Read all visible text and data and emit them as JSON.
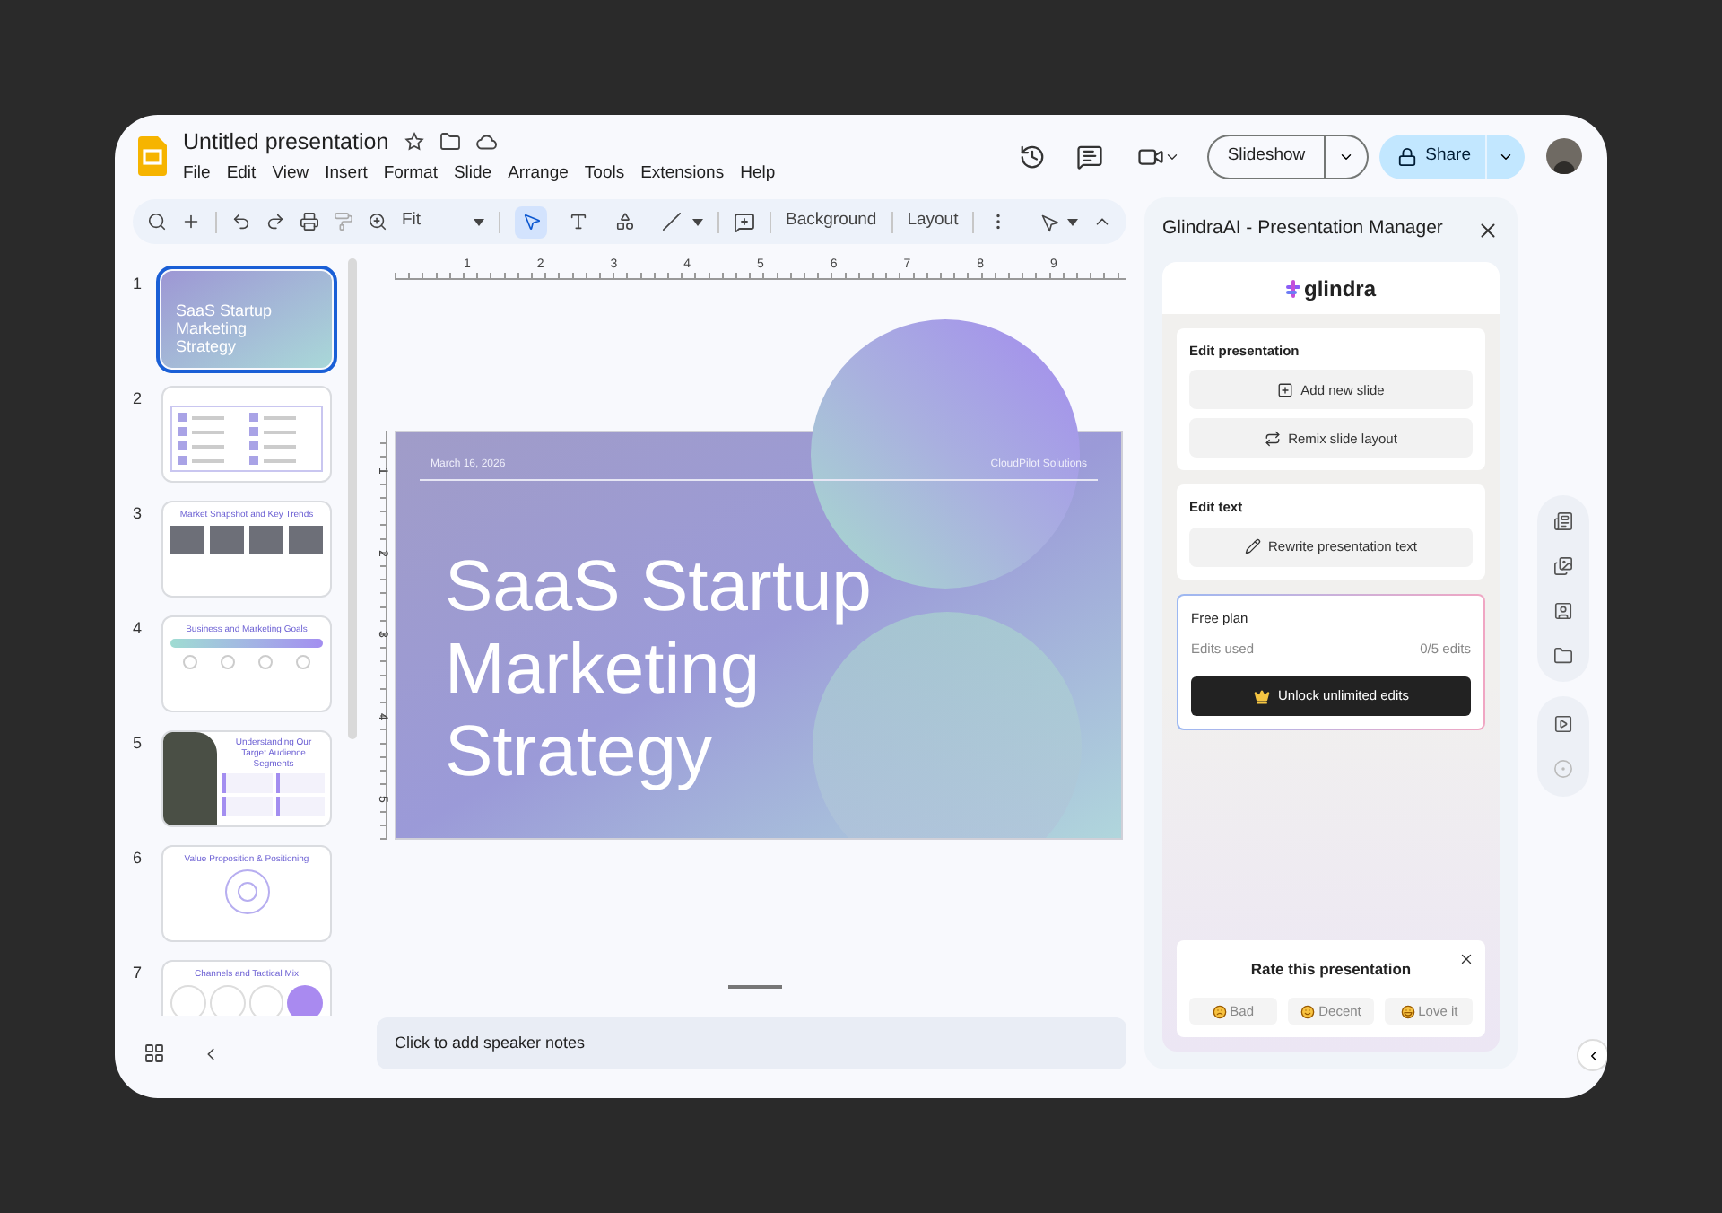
{
  "app": {
    "title": "Untitled presentation",
    "menu": [
      "File",
      "Edit",
      "View",
      "Insert",
      "Format",
      "Slide",
      "Arrange",
      "Tools",
      "Extensions",
      "Help"
    ]
  },
  "header": {
    "slideshow": "Slideshow",
    "share": "Share"
  },
  "toolbar": {
    "zoom": "Fit",
    "tools": [
      {
        "kind": "pointer",
        "selected": true
      },
      {
        "kind": "text",
        "selected": false
      },
      {
        "kind": "shape",
        "selected": false
      },
      {
        "kind": "line",
        "selected": false
      }
    ],
    "buttons": [
      "Background",
      "Layout"
    ]
  },
  "slides": [
    {
      "number": "1",
      "kind": "title",
      "title": "SaaS Startup Marketing Strategy",
      "selected": true
    },
    {
      "number": "2",
      "kind": "agenda",
      "selected": false
    },
    {
      "number": "3",
      "kind": "photos",
      "title": "Market Snapshot and Key Trends",
      "selected": false
    },
    {
      "number": "4",
      "kind": "goals",
      "title": "Business and Marketing Goals",
      "selected": false
    },
    {
      "number": "5",
      "kind": "split",
      "title": "Understanding Our Target Audience Segments",
      "selected": false
    },
    {
      "number": "6",
      "kind": "cycle",
      "title": "Value Proposition & Positioning",
      "selected": false
    },
    {
      "number": "7",
      "kind": "circles",
      "title": "Channels and Tactical Mix",
      "selected": false
    }
  ],
  "ruler": {
    "horizontal": [
      "1",
      "2",
      "3",
      "4",
      "5",
      "6",
      "7",
      "8",
      "9"
    ],
    "vertical": [
      "1",
      "2",
      "3",
      "4",
      "5"
    ]
  },
  "slide": {
    "date": "March 16, 2026",
    "company": "CloudPilot Solutions",
    "title_lines": [
      "SaaS Startup",
      "Marketing",
      "Strategy"
    ]
  },
  "notes": {
    "placeholder": "Click to add speaker notes"
  },
  "panel": {
    "title": "GlindraAI - Presentation Manager",
    "logo": "glindra",
    "sections": [
      {
        "heading": "Edit presentation",
        "actions": [
          {
            "kind": "add",
            "label": "Add new slide"
          },
          {
            "kind": "remix",
            "label": "Remix slide layout"
          }
        ]
      },
      {
        "heading": "Edit text",
        "actions": [
          {
            "kind": "rewrite",
            "label": "Rewrite presentation text"
          }
        ]
      }
    ],
    "plan": {
      "heading": "Free plan",
      "label": "Edits used",
      "count": "0/5 edits",
      "button": "Unlock unlimited edits"
    },
    "rating": {
      "title": "Rate this presentation",
      "options": [
        {
          "kind": "sad",
          "label": "Bad"
        },
        {
          "kind": "smile",
          "label": "Decent"
        },
        {
          "kind": "love",
          "label": "Love it"
        }
      ]
    }
  }
}
